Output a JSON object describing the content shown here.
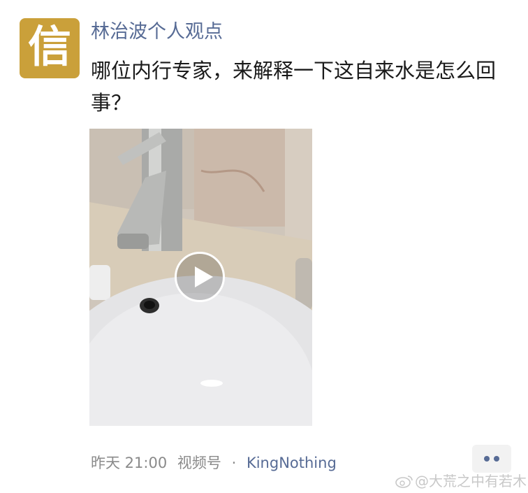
{
  "avatar": {
    "glyph": "信",
    "color": "#caa03a"
  },
  "post": {
    "author": "林治波个人观点",
    "text": "哪位内行专家，来解释一下这自来水是怎么回事？"
  },
  "video": {
    "play_icon": "play-icon"
  },
  "meta": {
    "time": "昨天 21:00",
    "source": "视频号",
    "separator": "·",
    "channel": "KingNothing"
  },
  "more_icon": "more-dots-icon",
  "watermark": {
    "icon": "weibo-icon",
    "text": "@大荒之中有若木"
  },
  "colors": {
    "link": "#576b95",
    "meta": "#8a8a8a",
    "text": "#1a1a1a"
  }
}
